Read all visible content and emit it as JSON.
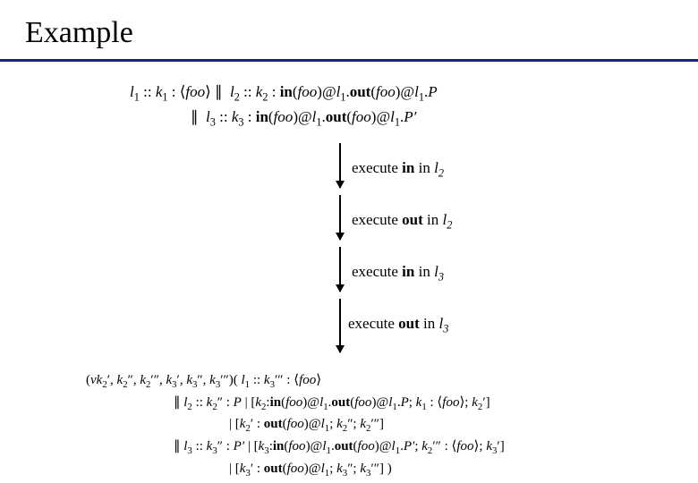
{
  "title": "Example",
  "formula_top": {
    "line1": "l₁ :: k₁ : ⟨foo⟩ ∥ l₂ :: k₂ : in(foo)@l₁.out(foo)@l₁.P",
    "line2": "∥  l₃ :: k₃ : in(foo)@l₁.out(foo)@l₁.P′"
  },
  "steps": [
    {
      "prefix": "execute ",
      "op": "in",
      "mid": " in ",
      "loc": "l",
      "sub": "2"
    },
    {
      "prefix": "execute ",
      "op": "out",
      "mid": " in ",
      "loc": "l",
      "sub": "2"
    },
    {
      "prefix": "execute ",
      "op": "in",
      "mid": " in ",
      "loc": "l",
      "sub": "3"
    },
    {
      "prefix": "execute ",
      "op": "out",
      "mid": " in ",
      "loc": "l",
      "sub": "3"
    }
  ],
  "formula_bot": {
    "line1": "(νk₂′, k₂′′, k₂′′′, k₃′, k₃′′, k₃′′′)( l₁ :: k₃′′′ : ⟨foo⟩",
    "line2": "∥ l₂ :: k₂′′ : P | [k₂ : in(foo)@l₁.out(foo)@l₁.P; k₁ : ⟨foo⟩; k₂′]",
    "line3": "| [k₂′ : out(foo)@l₁; k₂′′; k₂′′′]",
    "line4": "∥ l₃ :: k₃′′ : P′ | [k₃ : in(foo)@l₁.out(foo)@l₁.P′; k₂′′′ : ⟨foo⟩; k₃′]",
    "line5": "| [k₃′ : out(foo)@l₁; k₃′′; k₃′′′] )"
  }
}
